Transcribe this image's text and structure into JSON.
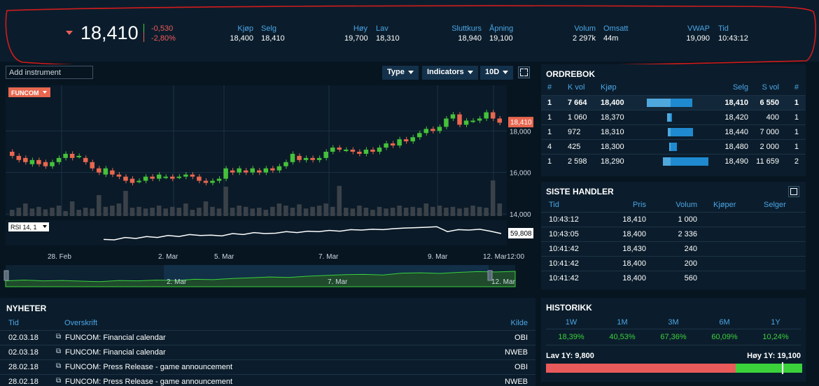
{
  "quote": {
    "last": "18,410",
    "change": "-0,530",
    "change_pct": "-2,80%",
    "colors": {
      "down": "#e95f5a",
      "up": "#3bd13b",
      "accent": "#4ba5e6"
    },
    "fields": [
      {
        "label": "Kjøp",
        "value": "18,400"
      },
      {
        "label": "Selg",
        "value": "18,410"
      },
      {
        "label": "Høy",
        "value": "19,700"
      },
      {
        "label": "Lav",
        "value": "18,310"
      },
      {
        "label": "Sluttkurs",
        "value": "18,940"
      },
      {
        "label": "Åpning",
        "value": "19,100"
      },
      {
        "label": "Volum",
        "value": "2 297k"
      },
      {
        "label": "Omsatt",
        "value": "44m"
      },
      {
        "label": "VWAP",
        "value": "19,090"
      },
      {
        "label": "Tid",
        "value": "10:43:12"
      }
    ]
  },
  "toolbar": {
    "add_instrument_placeholder": "Add instrument",
    "type_label": "Type",
    "indicators_label": "Indicators",
    "period_label": "10D",
    "expand_icon": "expand-icon"
  },
  "chart_data": {
    "type": "candlestick",
    "instrument_label": "FUNCOM",
    "last_label": "18,410",
    "y_ticks": [
      "18,000",
      "16,000",
      "14,000"
    ],
    "y_tick_values": [
      18,
      16,
      14
    ],
    "x_labels": [
      "28. Feb",
      "2. Mar",
      "5. Mar",
      "7. Mar",
      "9. Mar",
      "12. Mar",
      "12:00"
    ],
    "ylim": [
      13.9,
      20.2
    ],
    "candles": [
      [
        17.0,
        16.8
      ],
      [
        16.8,
        16.6
      ],
      [
        16.7,
        16.5
      ],
      [
        16.4,
        16.6
      ],
      [
        16.6,
        16.4
      ],
      [
        16.5,
        16.3
      ],
      [
        16.3,
        16.5
      ],
      [
        16.5,
        16.7
      ],
      [
        16.7,
        16.9
      ],
      [
        16.9,
        16.7
      ],
      [
        16.8,
        16.8
      ],
      [
        16.7,
        16.5
      ],
      [
        16.5,
        16.2
      ],
      [
        16.2,
        16.0
      ],
      [
        15.9,
        16.2
      ],
      [
        16.1,
        15.9
      ],
      [
        15.9,
        15.8
      ],
      [
        15.8,
        15.6
      ],
      [
        15.7,
        15.5
      ],
      [
        15.6,
        15.6
      ],
      [
        15.6,
        15.8
      ],
      [
        15.8,
        15.7
      ],
      [
        15.7,
        15.9
      ],
      [
        15.8,
        15.8
      ],
      [
        15.8,
        15.7
      ],
      [
        15.8,
        15.8
      ],
      [
        15.8,
        15.9
      ],
      [
        15.9,
        15.8
      ],
      [
        15.8,
        15.6
      ],
      [
        15.6,
        15.5
      ],
      [
        15.5,
        15.6
      ],
      [
        15.6,
        15.7
      ],
      [
        15.7,
        16.2
      ],
      [
        16.1,
        16.0
      ],
      [
        16.0,
        16.2
      ],
      [
        16.1,
        16.0
      ],
      [
        16.0,
        16.2
      ],
      [
        16.1,
        16.0
      ],
      [
        16.0,
        16.2
      ],
      [
        16.2,
        16.1
      ],
      [
        16.1,
        16.3
      ],
      [
        16.3,
        16.5
      ],
      [
        16.5,
        16.9
      ],
      [
        16.8,
        16.6
      ],
      [
        16.6,
        16.7
      ],
      [
        16.7,
        16.6
      ],
      [
        16.6,
        16.7
      ],
      [
        16.7,
        17.0
      ],
      [
        17.0,
        17.2
      ],
      [
        17.2,
        17.1
      ],
      [
        17.1,
        17.1
      ],
      [
        17.1,
        17.0
      ],
      [
        17.0,
        16.9
      ],
      [
        16.9,
        17.1
      ],
      [
        17.1,
        17.0
      ],
      [
        17.0,
        17.2
      ],
      [
        17.2,
        17.4
      ],
      [
        17.4,
        17.3
      ],
      [
        17.3,
        17.6
      ],
      [
        17.6,
        17.5
      ],
      [
        17.5,
        17.7
      ],
      [
        17.7,
        17.9
      ],
      [
        17.9,
        18.1
      ],
      [
        18.1,
        18.0
      ],
      [
        18.0,
        18.2
      ],
      [
        18.2,
        18.6
      ],
      [
        18.6,
        18.8
      ],
      [
        18.8,
        18.3
      ],
      [
        18.3,
        18.5
      ],
      [
        18.5,
        18.5
      ],
      [
        18.5,
        18.6
      ],
      [
        18.6,
        18.9
      ],
      [
        18.9,
        18.6
      ],
      [
        18.6,
        18.4
      ]
    ],
    "volume": [
      0.15,
      0.2,
      0.3,
      0.18,
      0.22,
      0.16,
      0.2,
      0.25,
      0.12,
      0.35,
      0.15,
      0.2,
      0.18,
      0.5,
      0.22,
      0.25,
      0.3,
      0.6,
      0.2,
      0.22,
      0.18,
      0.2,
      0.25,
      0.18,
      0.22,
      0.2,
      0.3,
      0.15,
      0.2,
      0.35,
      0.22,
      0.18,
      0.7,
      0.2,
      0.25,
      0.22,
      0.18,
      0.2,
      0.15,
      0.22,
      0.3,
      0.25,
      0.2,
      0.28,
      0.18,
      0.22,
      0.25,
      0.3,
      0.22,
      0.72,
      0.2,
      0.18,
      0.25,
      0.2,
      0.15,
      0.22,
      0.18,
      0.2,
      0.25,
      0.2,
      0.22,
      0.2,
      0.3,
      0.22,
      0.25,
      0.2,
      0.22,
      0.18,
      0.2,
      0.25,
      0.22,
      0.2,
      0.85,
      0.3
    ],
    "rsi_label": "RSI 14, 1",
    "rsi_value": "59,808",
    "rsi": [
      0.2,
      0.18,
      0.3,
      0.25,
      0.35,
      0.3,
      0.4,
      0.35,
      0.45,
      0.4,
      0.42,
      0.38,
      0.5,
      0.45,
      0.55,
      0.5,
      0.52,
      0.6,
      0.55,
      0.62,
      0.6,
      0.66,
      0.62,
      0.7,
      0.68,
      0.72,
      0.7,
      0.75,
      0.78,
      0.8,
      0.82,
      0.85,
      0.6,
      0.7,
      0.68,
      0.72,
      0.62,
      0.5
    ],
    "navigator_labels": [
      "2. Mar",
      "7. Mar",
      "12. Mar"
    ],
    "navigator": [
      0.2,
      0.25,
      0.2,
      0.22,
      0.18,
      0.15,
      0.22,
      0.2,
      0.25,
      0.22,
      0.3,
      0.28,
      0.35,
      0.4,
      0.45,
      0.42,
      0.5,
      0.55,
      0.6,
      0.62,
      0.58,
      0.7,
      0.72,
      0.68,
      0.75,
      0.8,
      0.78,
      0.82
    ]
  },
  "orderbook": {
    "title": "ORDREBOK",
    "headers": [
      "#",
      "K vol",
      "Kjøp",
      "Selg",
      "S vol",
      "#"
    ],
    "rows": [
      {
        "n1": "1",
        "kvol": "7 664",
        "kjop": "18,400",
        "selg": "18,410",
        "svol": "6 550",
        "n2": "1",
        "buy": 0.48,
        "sell": 0.51
      },
      {
        "n1": "1",
        "kvol": "1 060",
        "kjop": "18,370",
        "selg": "18,420",
        "svol": "400",
        "n2": "1",
        "buy": 0.07,
        "sell": 0.03
      },
      {
        "n1": "1",
        "kvol": "972",
        "kjop": "18,310",
        "selg": "18,440",
        "svol": "7 000",
        "n2": "1",
        "buy": 0.06,
        "sell": 0.54
      },
      {
        "n1": "4",
        "kvol": "425",
        "kjop": "18,300",
        "selg": "18,480",
        "svol": "2 000",
        "n2": "1",
        "buy": 0.03,
        "sell": 0.15
      },
      {
        "n1": "1",
        "kvol": "2 598",
        "kjop": "18,290",
        "selg": "18,490",
        "svol": "11 659",
        "n2": "2",
        "buy": 0.16,
        "sell": 0.9
      }
    ]
  },
  "trades": {
    "title": "SISTE HANDLER",
    "headers": [
      "Tid",
      "Pris",
      "Volum",
      "Kjøper",
      "Selger"
    ],
    "rows": [
      {
        "tid": "10:43:12",
        "pris": "18,410",
        "volum": "1 000"
      },
      {
        "tid": "10:43:05",
        "pris": "18,400",
        "volum": "2 336"
      },
      {
        "tid": "10:41:42",
        "pris": "18,430",
        "volum": "240"
      },
      {
        "tid": "10:41:42",
        "pris": "18,400",
        "volum": "200"
      },
      {
        "tid": "10:41:42",
        "pris": "18,400",
        "volum": "560"
      }
    ]
  },
  "news": {
    "title": "NYHETER",
    "headers": [
      "Tid",
      "Overskrift",
      "Kilde"
    ],
    "rows": [
      {
        "tid": "02.03.18",
        "headline": "FUNCOM: Financial calendar",
        "kilde": "OBI"
      },
      {
        "tid": "02.03.18",
        "headline": "FUNCOM: Financial calendar",
        "kilde": "NWEB"
      },
      {
        "tid": "28.02.18",
        "headline": "FUNCOM: Press Release - game announcement",
        "kilde": "OBI"
      },
      {
        "tid": "28.02.18",
        "headline": "FUNCOM: Press Release - game announcement",
        "kilde": "NWEB"
      }
    ]
  },
  "history": {
    "title": "HISTORIKK",
    "periods": [
      {
        "label": "1W",
        "value": "18,39%"
      },
      {
        "label": "1M",
        "value": "40,53%"
      },
      {
        "label": "3M",
        "value": "67,36%"
      },
      {
        "label": "6M",
        "value": "60,09%"
      },
      {
        "label": "1Y",
        "value": "10,24%"
      }
    ],
    "low_label": "Lav 1Y: 9,800",
    "high_label": "Høy 1Y: 19,100",
    "range_position": 0.92
  }
}
